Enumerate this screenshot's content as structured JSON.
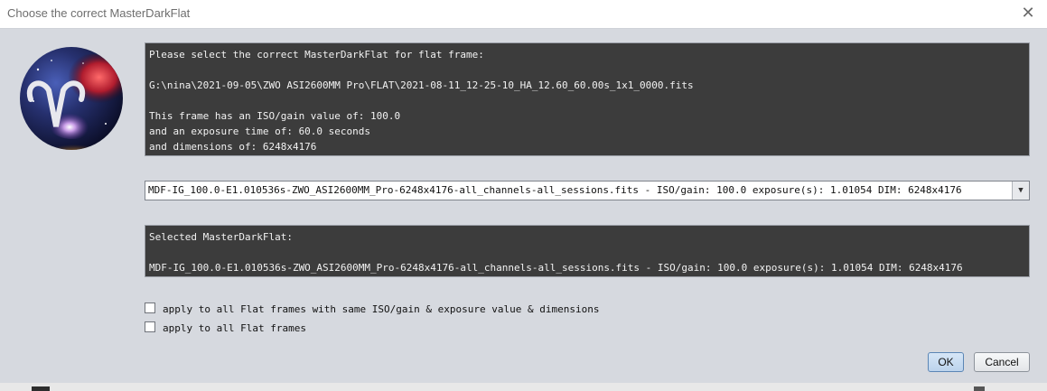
{
  "window": {
    "title": "Choose the correct MasterDarkFlat",
    "close_icon": "close-icon"
  },
  "info": {
    "line1": "Please select the correct MasterDarkFlat for flat frame:",
    "file_path": "G:\\nina\\2021-09-05\\ZWO ASI2600MM Pro\\FLAT\\2021-08-11_12-25-10_HA_12.60_60.00s_1x1_0000.fits",
    "iso_line": "This frame has an ISO/gain value of: 100.0",
    "exposure_line": "and an exposure time of: 60.0 seconds",
    "dimensions_line": "and dimensions of: 6248x4176"
  },
  "dropdown": {
    "selected": "MDF-IG_100.0-E1.010536s-ZWO_ASI2600MM_Pro-6248x4176-all_channels-all_sessions.fits - ISO/gain: 100.0 exposure(s): 1.01054 DIM: 6248x4176",
    "arrow_icon": "chevron-down-icon"
  },
  "selected": {
    "heading": "Selected MasterDarkFlat:",
    "value": "MDF-IG_100.0-E1.010536s-ZWO_ASI2600MM_Pro-6248x4176-all_channels-all_sessions.fits - ISO/gain: 100.0 exposure(s): 1.01054 DIM: 6248x4176"
  },
  "options": {
    "apply_same": "apply to all Flat frames with same ISO/gain & exposure value & dimensions",
    "apply_all": "apply to all Flat frames"
  },
  "buttons": {
    "ok": "OK",
    "cancel": "Cancel"
  },
  "colors": {
    "panel_bg": "#3c3c3c",
    "panel_text": "#f2f2f2",
    "dialog_bg": "#d6d9df"
  }
}
